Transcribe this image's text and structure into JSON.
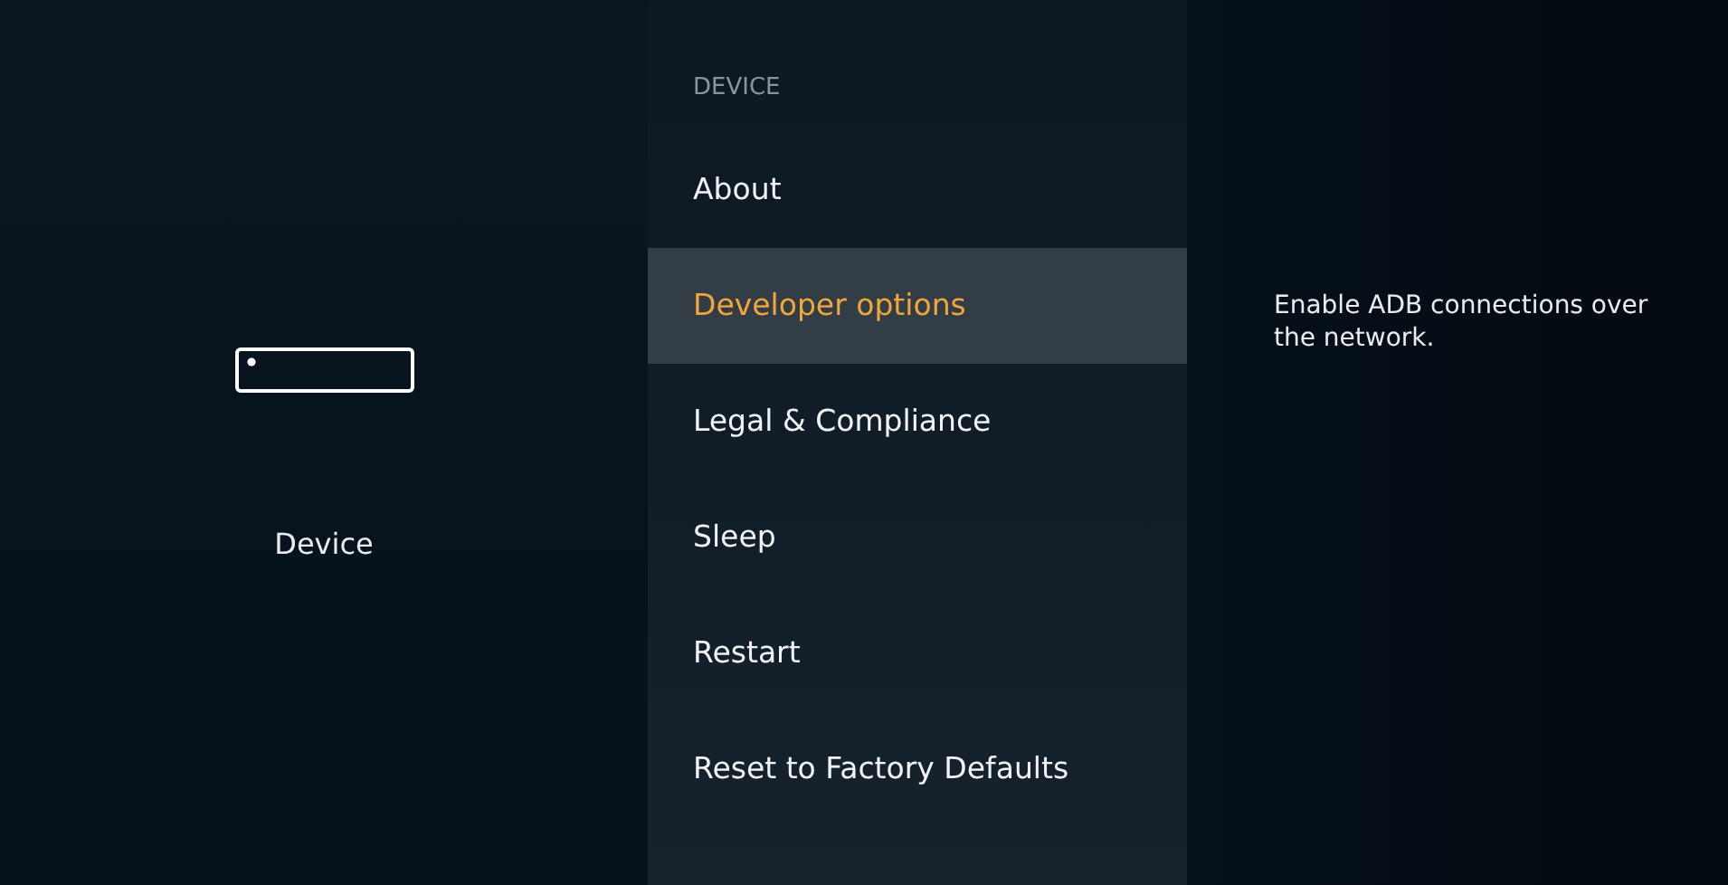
{
  "category": {
    "label": "Device"
  },
  "menu": {
    "heading": "DEVICE",
    "items": [
      {
        "label": "About",
        "selected": false
      },
      {
        "label": "Developer options",
        "selected": true
      },
      {
        "label": "Legal & Compliance",
        "selected": false
      },
      {
        "label": "Sleep",
        "selected": false
      },
      {
        "label": "Restart",
        "selected": false
      },
      {
        "label": "Reset to Factory Defaults",
        "selected": false
      }
    ]
  },
  "description": "Enable ADB connections over the network."
}
